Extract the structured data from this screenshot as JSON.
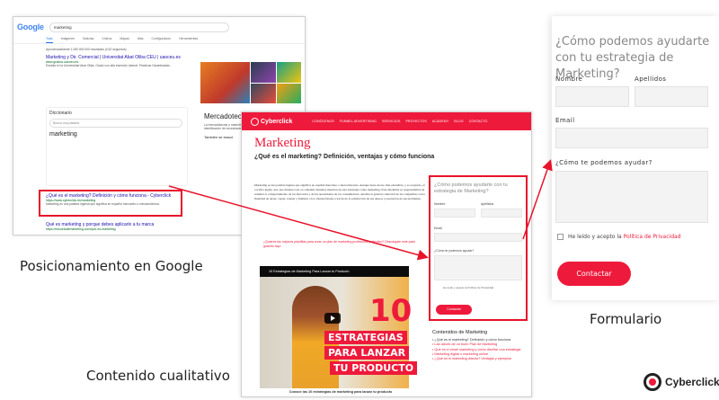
{
  "captions": {
    "google": "Posicionamiento en Google",
    "content": "Contenido cualitativo",
    "form": "Formulario"
  },
  "google": {
    "logo": "Google",
    "query": "marketing",
    "tabs": [
      "Todo",
      "Imágenes",
      "Noticias",
      "Vídeos",
      "Mapas",
      "Más",
      "Configuración",
      "Herramientas"
    ],
    "stats": "Aproximadamente 1.280.000.000 resultados (0,62 segundos)",
    "result1": {
      "title": "Marketing y Dir. Comercial | Universitat Abat Oliba CEU | uaoceu.es",
      "url": "www.grados.uaoceu.es",
      "snippet": "Estudia en la Universidad Abat Oliba. Grado con alta inserción laboral. Prácticas Garantizadas."
    },
    "dictionary": {
      "heading": "Diccionario",
      "placeholder": "Busca una palabra",
      "word": "marketing"
    },
    "knowledge": {
      "title": "Mercadotecnia",
      "text": "La mercadotecnia o marketing, es un proceso que comprende la identificación de necesidades y deseos del mercado objetivo.",
      "also": "También se buscó"
    },
    "result2": {
      "title": "¿Qué es el marketing? Definición y cómo funciona - Cyberclick",
      "url": "https://www.cyberclick.es/marketing",
      "snippet": "Marketing es una palabra inglesa que significa en español mercadeo o mercadotecnia."
    },
    "result3": {
      "title": "Qué es marketing y porque debes aplicarlo a tu marca",
      "url": "https://escuelademarketing.com/que-es-marketing"
    }
  },
  "site": {
    "logo": "Cyberclick",
    "nav": [
      "CONÓCENOS",
      "FUNNEL ADVERTISING",
      "SERVICIOS",
      "PROYECTOS",
      "ACADEMY",
      "BLOG",
      "CONTACTO"
    ],
    "h1": "Marketing",
    "h2": "¿Qué es el marketing? Definición, ventajas y cómo funciona",
    "body": "Marketing es una palabra inglesa que significa en español mercadeo o mercadotecnia. Aunque tiene un uso más extendido, y es aceptado, el vocablo inglés. Así, que durante todo el contenido haremos mención de esta estrategia como marketing. Esta disciplina se responsabiliza de estudiar el comportamiento de los mercados y de las necesidades de los consumidores. Analiza la gestión comercial de las compañías con la finalidad de atraer, captar, retener y fidelizar a los clientes finales a través de la satisfacción de sus deseos y resolución de sus problemas.",
    "bullet1": "¿Quieres las mejores plantillas para crear un plan de marketing profesional y efectivo? Descárgate este pack gratuito aquí",
    "video_title": "10 Estrategias de Marketing Para Lanzar tu Producto",
    "video_num": "10",
    "video_lines": [
      "ESTRATEGIAS",
      "PARA LANZAR",
      "TU PRODUCTO"
    ],
    "video_caption": "Conoce las 10 estrategias de marketing para lanzar tu producto",
    "side_form": {
      "title": "¿Cómo podemos ayudarte con tu estrategia de Marketing?",
      "nombre": "Nombre",
      "apellidos": "Apellidos",
      "email": "Email",
      "ayuda": "¿Cómo te podemos ayudar?",
      "check": "He leído y acepto la Política de Privacidad",
      "button": "Contactar"
    },
    "toc": {
      "heading": "Contenidos de Marketing",
      "items": [
        "¿Qué es el marketing? Definición y cómo funciona",
        "Las claves de un buen Plan de Marketing",
        "Qué es el email marketing y cómo diseñar una estrategia",
        "Marketing digital o marketing online",
        "¿Qué es el marketing directo? Ventajas y ejemplos"
      ]
    }
  },
  "form": {
    "title": "¿Cómo podemos ayudarte con tu estrategia de Marketing?",
    "nombre": "Nombre",
    "apellidos": "Apellidos",
    "email": "Email",
    "ayuda": "¿Cómo te podemos ayudar?",
    "check_text": "He leído y acepto la ",
    "check_link": "Política de Privacidad",
    "button": "Contactar"
  },
  "brand": "Cyberclick",
  "colors": {
    "accent": "#ee1a3b",
    "highlight": "#e8132a"
  }
}
